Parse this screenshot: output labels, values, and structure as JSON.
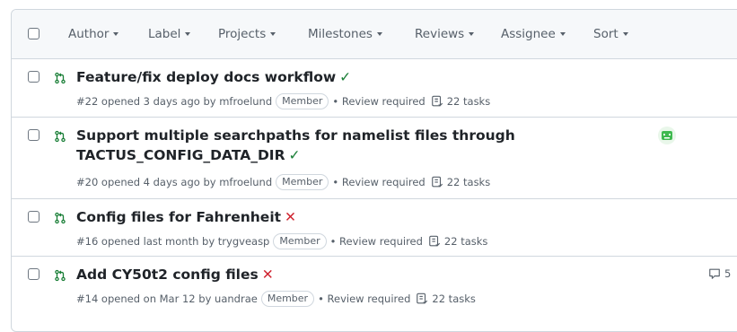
{
  "filters": [
    {
      "label": "Author"
    },
    {
      "label": "Label"
    },
    {
      "label": "Projects"
    },
    {
      "label": "Milestones"
    },
    {
      "label": "Reviews"
    },
    {
      "label": "Assignee"
    },
    {
      "label": "Sort"
    }
  ],
  "pull_requests": [
    {
      "title_line1": "Feature/fix deploy docs workflow",
      "title_line2": "",
      "status": "success",
      "status_symbol": "✓",
      "number_text": "#22 opened 3 days ago by",
      "author": "mfroelund",
      "badge": "Member",
      "review": "• Review required",
      "tasks": "22 tasks"
    },
    {
      "title_line1": "Support multiple searchpaths for namelist files through",
      "title_line2": "TACTUS_CONFIG_DATA_DIR",
      "status": "success",
      "status_symbol": "✓",
      "number_text": "#20 opened 4 days ago by",
      "author": "mfroelund",
      "badge": "Member",
      "review": "• Review required",
      "tasks": "22 tasks"
    },
    {
      "title_line1": "Config files for Fahrenheit",
      "title_line2": "",
      "status": "failure",
      "status_symbol": "✕",
      "number_text": "#16 opened last month by",
      "author": "trygveasp",
      "badge": "Member",
      "review": "• Review required",
      "tasks": "22 tasks"
    },
    {
      "title_line1": "Add CY50t2 config files",
      "title_line2": "",
      "status": "failure",
      "status_symbol": "✕",
      "number_text": "#14 opened on Mar 12 by",
      "author": "uandrae",
      "badge": "Member",
      "review": "• Review required",
      "tasks": "22 tasks",
      "comments": "5"
    }
  ],
  "colors": {
    "success": "#1a7f37",
    "failure": "#cf222e",
    "open_pr": "#1a7f37"
  },
  "icons": {
    "pr": "git-pull-request-icon",
    "tasks": "checklist-icon",
    "comment": "comment-icon",
    "avatar": "avatar-icon"
  }
}
